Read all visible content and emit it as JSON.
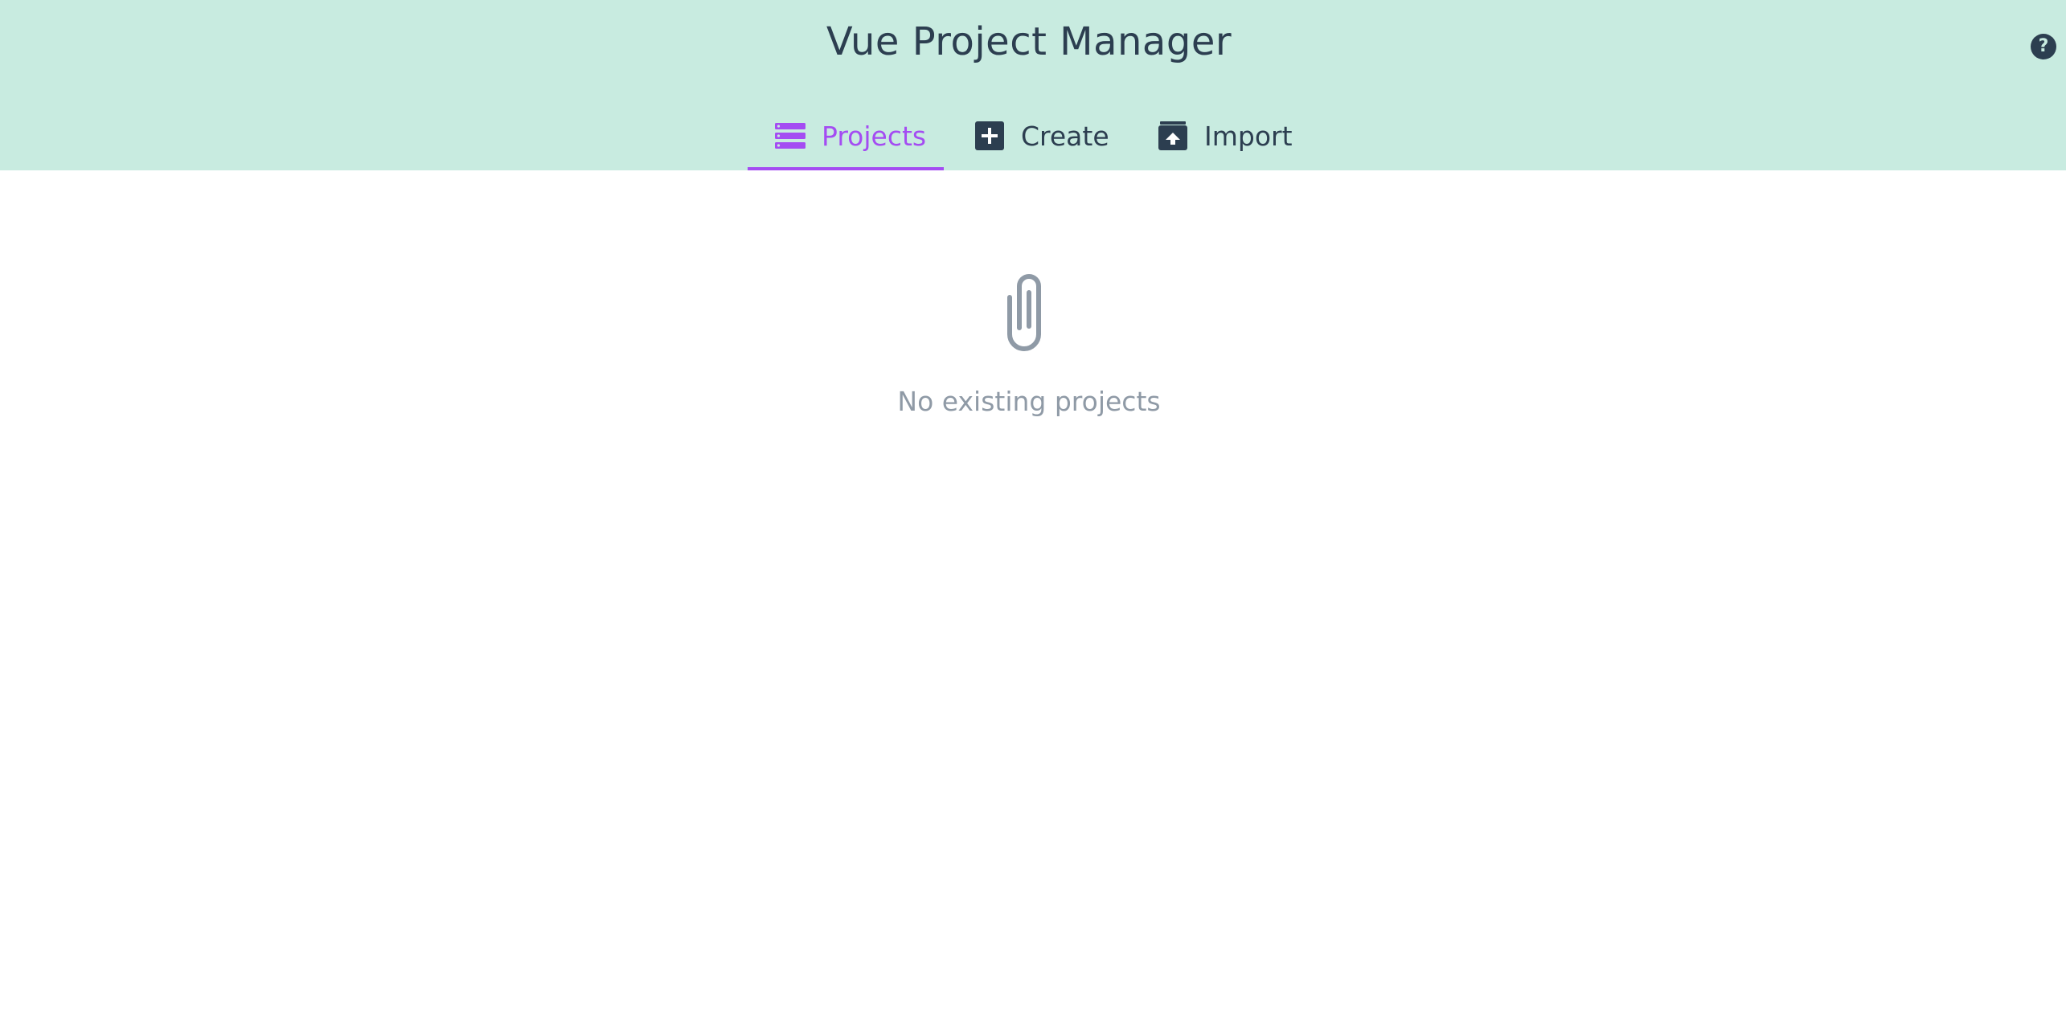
{
  "app": {
    "title": "Vue Project Manager",
    "help_label": "?"
  },
  "tabs": [
    {
      "label": "Projects",
      "icon": "list-icon",
      "active": true
    },
    {
      "label": "Create",
      "icon": "plus-square-icon",
      "active": false
    },
    {
      "label": "Import",
      "icon": "archive-upload-icon",
      "active": false
    }
  ],
  "empty_state": {
    "icon": "paperclip-icon",
    "message": "No existing projects"
  },
  "colors": {
    "header_bg": "#c8ebe0",
    "accent": "#a44cf2",
    "text_dark": "#2c3e50",
    "text_muted": "#8f9aa6"
  }
}
